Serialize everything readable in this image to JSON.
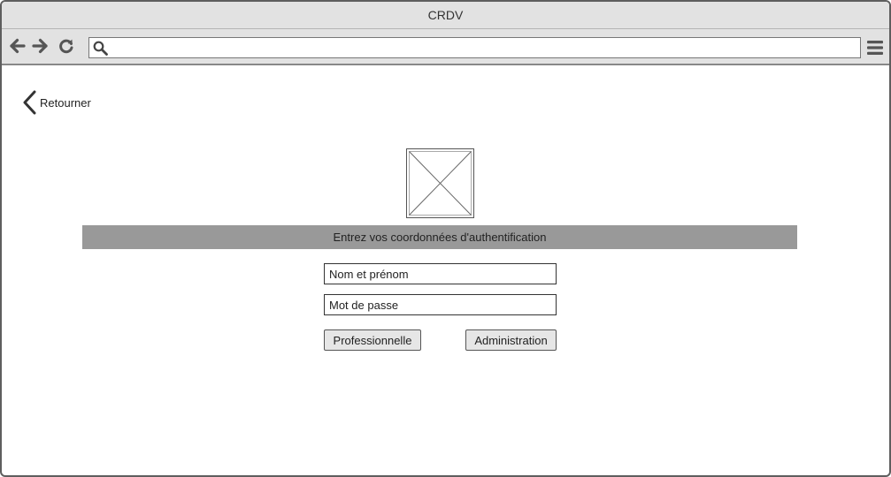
{
  "window": {
    "title": "CRDV"
  },
  "browser": {
    "address_value": "",
    "icons": [
      "arrow-left-icon",
      "arrow-right-icon",
      "reload-icon",
      "search-icon",
      "hamburger-menu-icon"
    ]
  },
  "page": {
    "back_label": "Retourner",
    "banner_text": "Entrez vos coordonnées d'authentification",
    "form": {
      "name_placeholder": "Nom et prénom",
      "password_placeholder": "Mot de passe",
      "professional_button": "Professionnelle",
      "admin_button": "Administration"
    }
  },
  "colors": {
    "chrome": "#e2e2e2",
    "banner": "#999999",
    "button": "#e6e6e6",
    "border": "#5e5e5e"
  }
}
